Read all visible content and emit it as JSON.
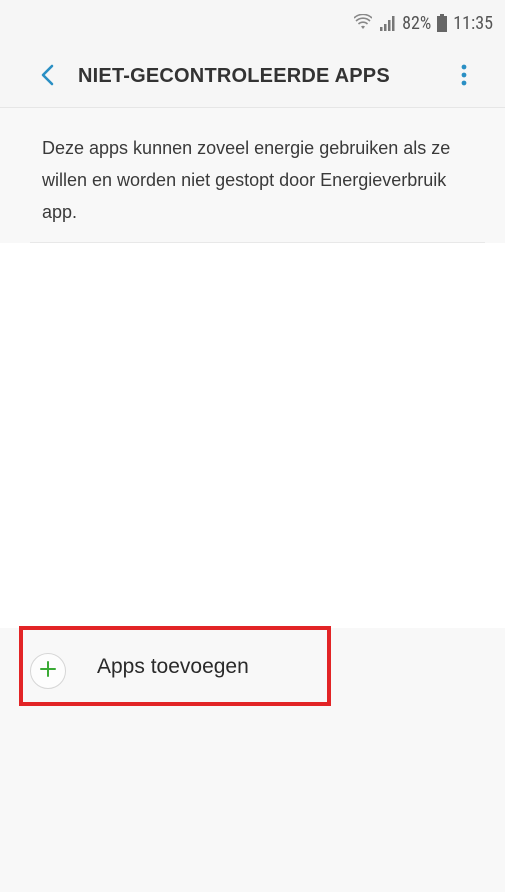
{
  "status_bar": {
    "battery": "82%",
    "time": "11:35",
    "icons": [
      "wifi-icon",
      "signal-icon",
      "battery-icon"
    ]
  },
  "header": {
    "title": "NIET-GECONTROLEERDE APPS",
    "back_icon": "chevron-left-icon",
    "more_icon": "more-vertical-icon"
  },
  "description": "Deze apps kunnen zoveel energie gebruiken als ze willen en worden niet gestopt door Energieverbruik app.",
  "add_apps": {
    "label": "Apps toevoegen",
    "icon": "plus-icon"
  },
  "colors": {
    "accent": "#2a8fc4",
    "plus": "#3aaa35",
    "highlight": "#e22426"
  }
}
